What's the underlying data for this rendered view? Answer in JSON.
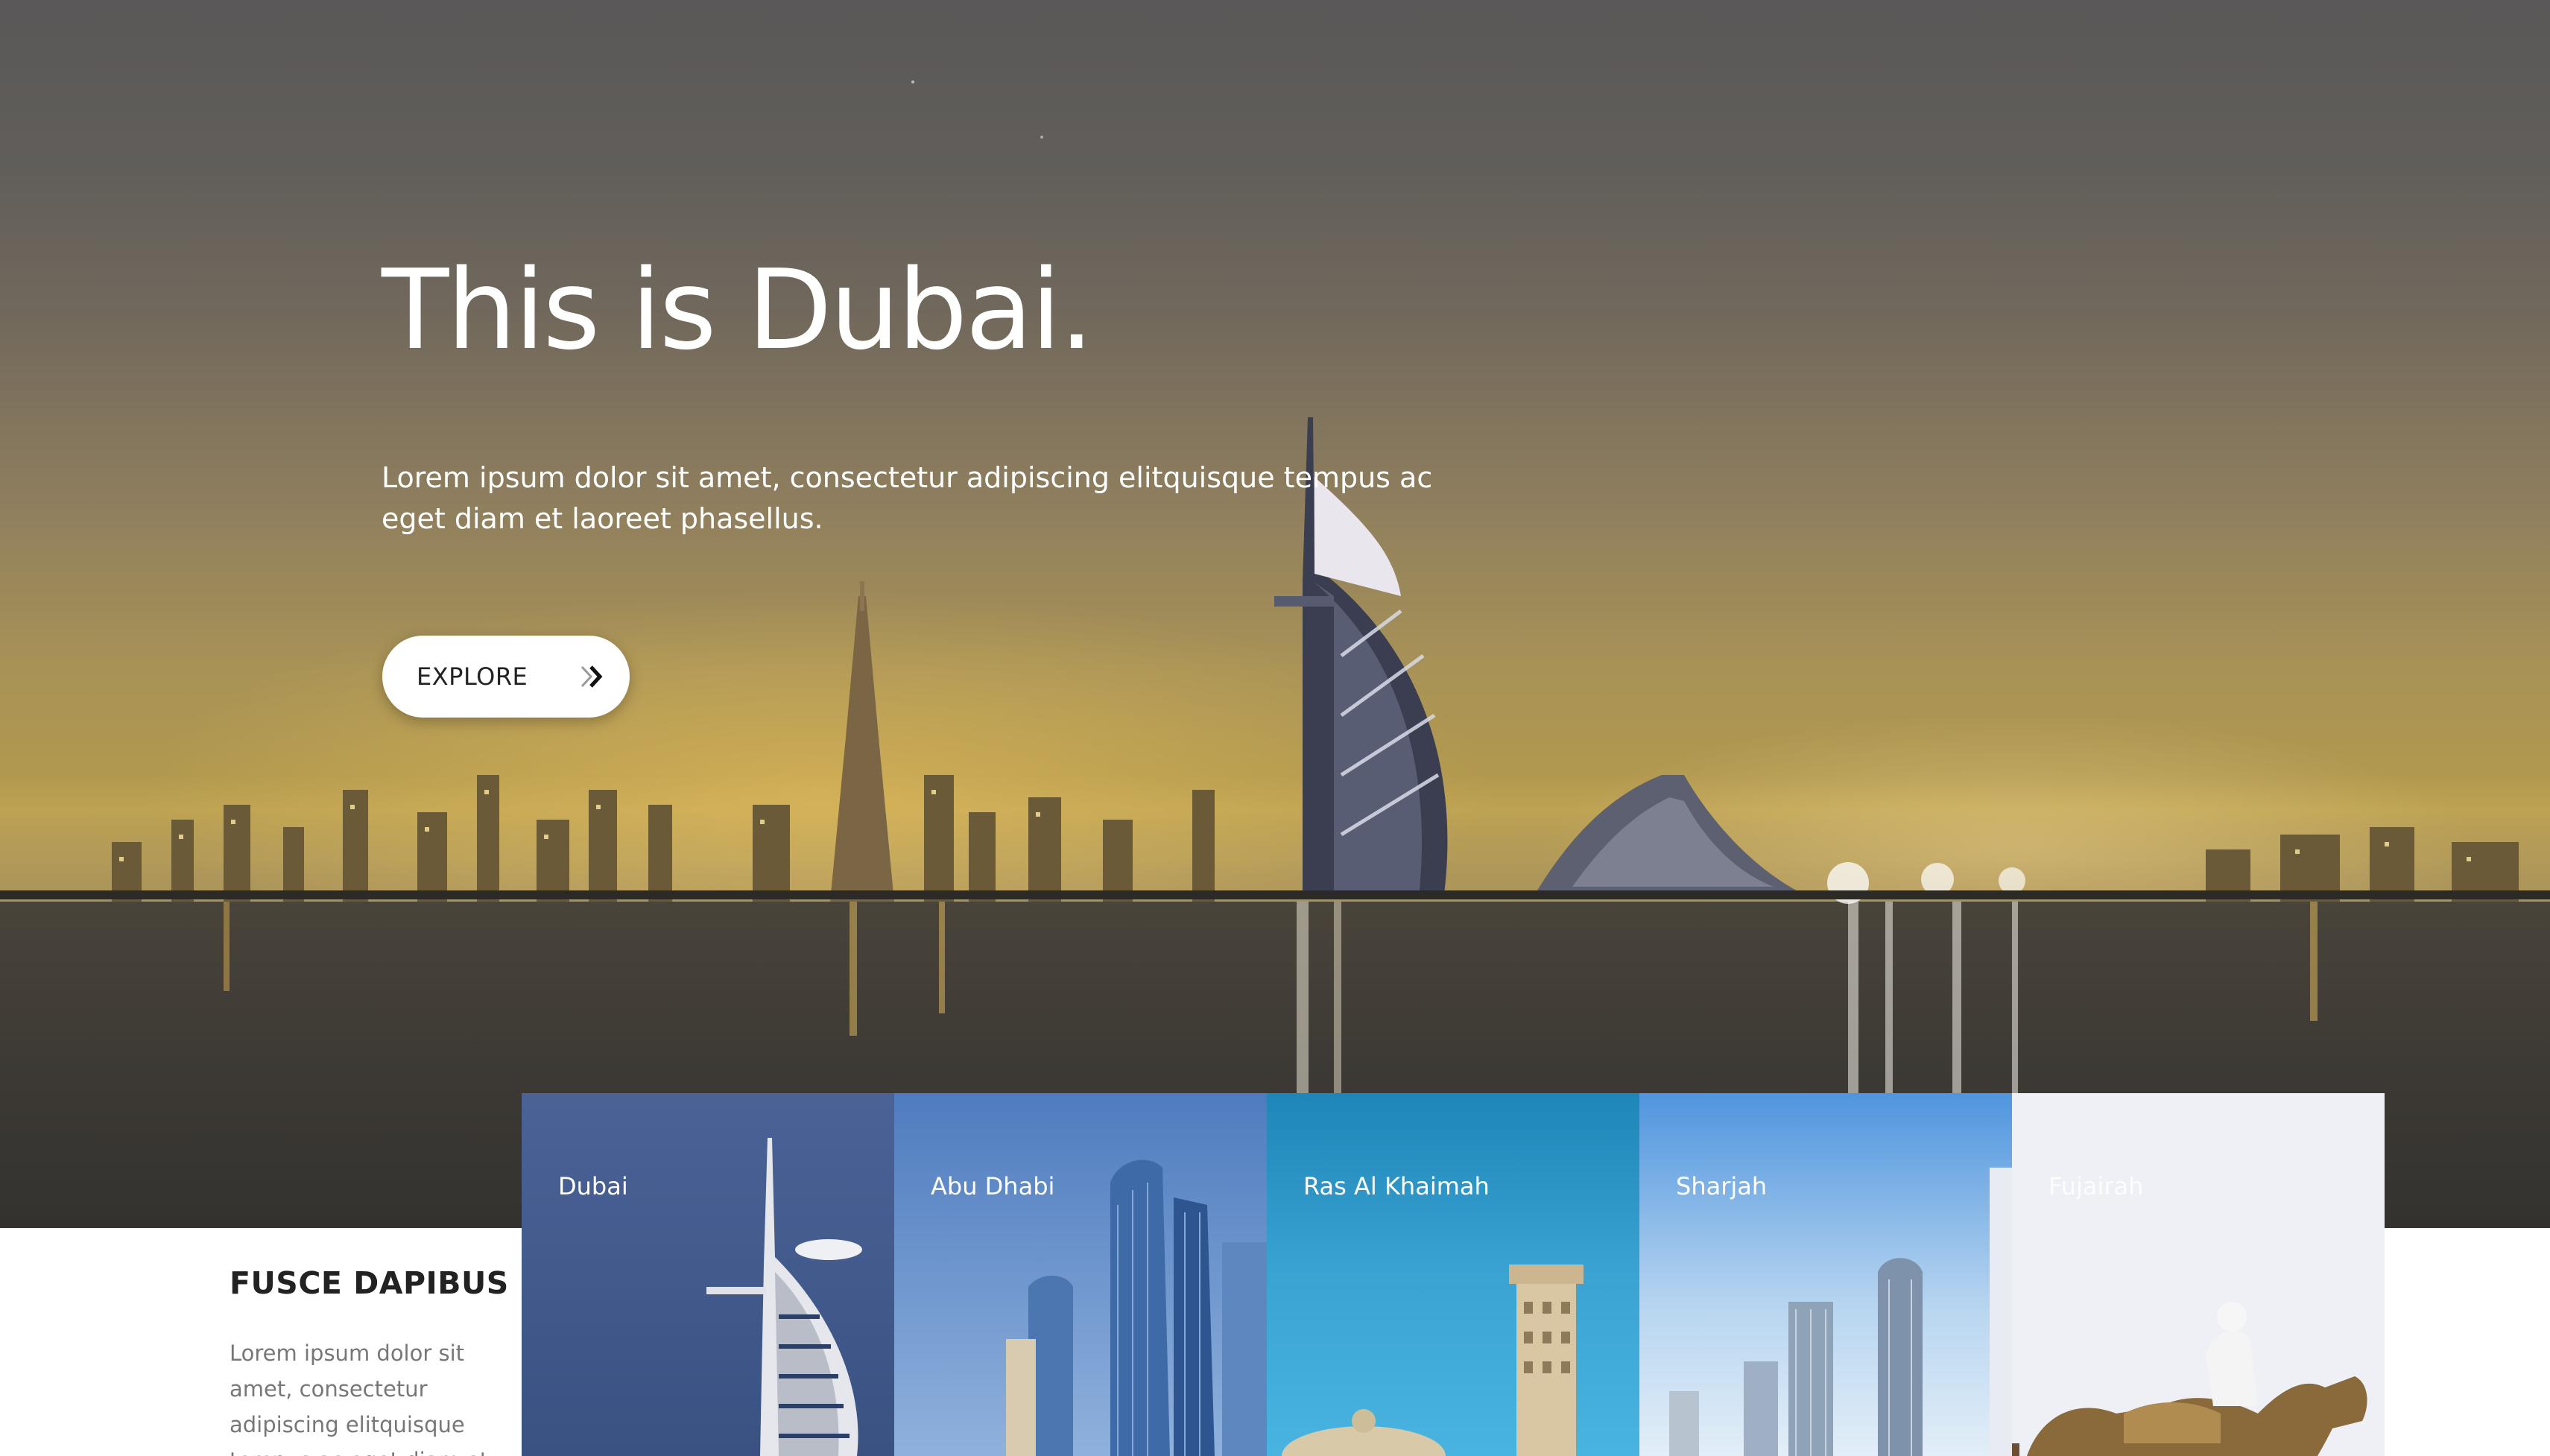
{
  "hero": {
    "title": "This is Dubai.",
    "description": "Lorem ipsum dolor sit amet, consectetur adipiscing elitquisque tempus ac eget diam et laoreet phasellus.",
    "explore_label": "EXPLORE",
    "explore_icon": "double-chevron-right-icon"
  },
  "sidebar": {
    "heading": "FUSCE DAPIBUS",
    "text": "Lorem ipsum dolor sit amet, consectetur adipiscing elitquisque tempus ac eget diam et laoreet"
  },
  "cards": [
    {
      "label": "Dubai",
      "color": "#4a6296"
    },
    {
      "label": "Abu Dhabi",
      "color": "#5a88c8"
    },
    {
      "label": "Ras Al Khaimah",
      "color": "#2f92c2"
    },
    {
      "label": "Sharjah",
      "color": "#5aa0e4"
    },
    {
      "label": "Fujairah",
      "color": "#eef0f6"
    }
  ]
}
